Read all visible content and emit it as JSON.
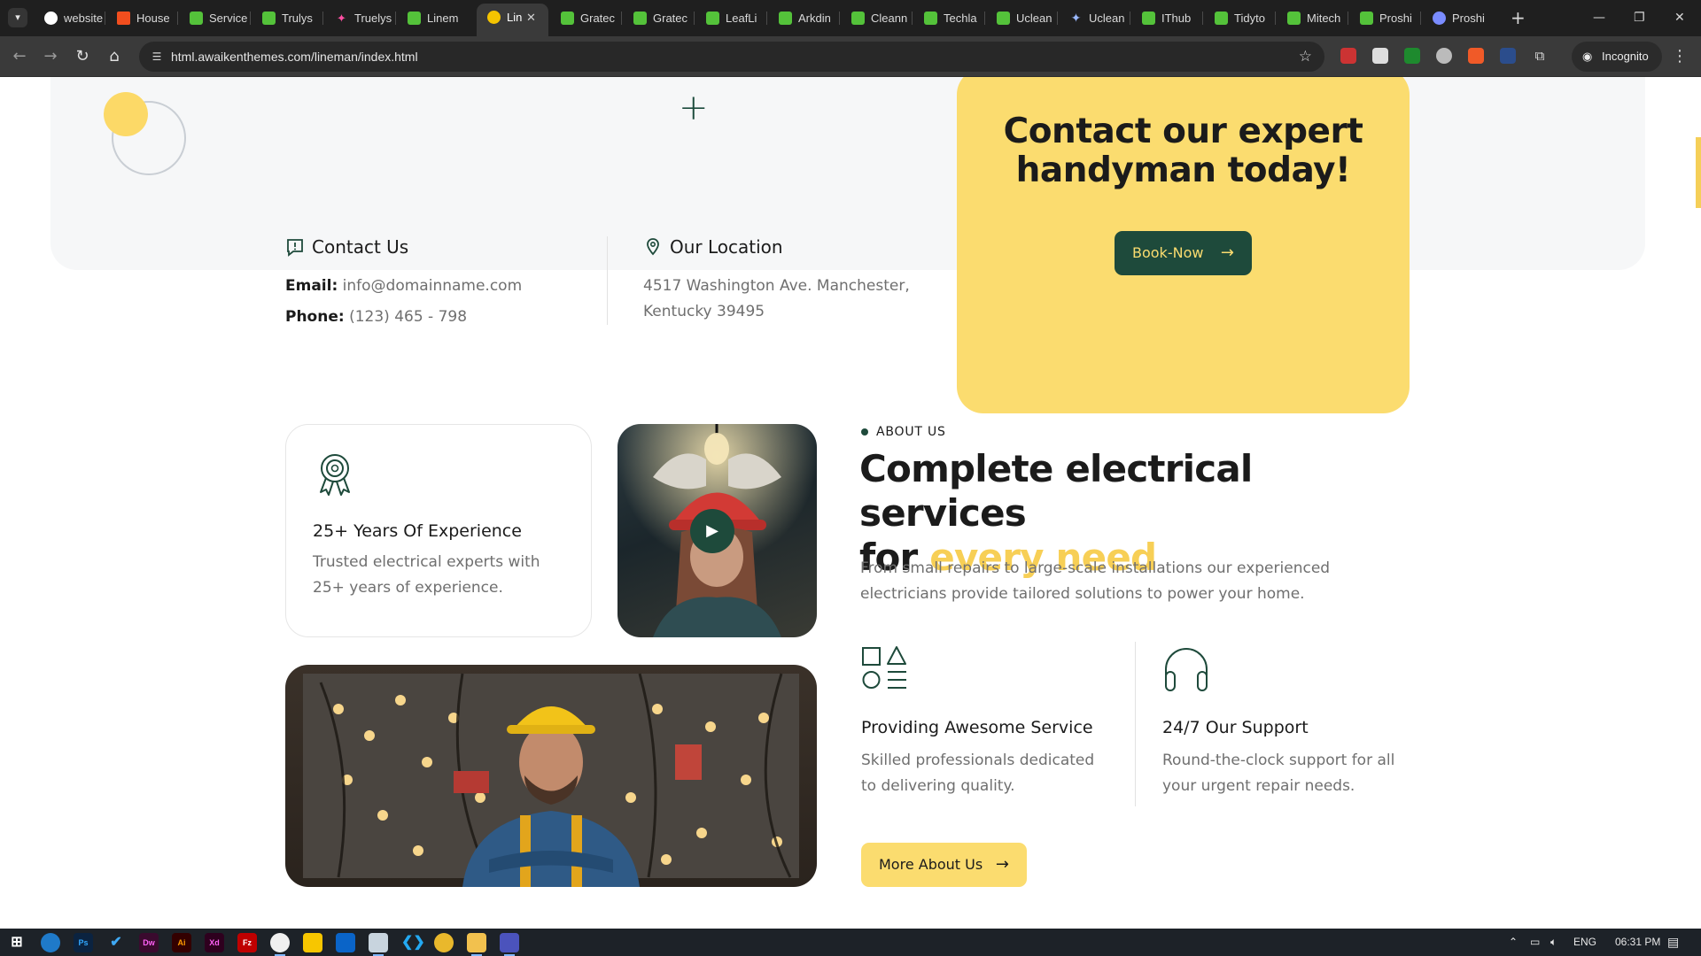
{
  "browser": {
    "tabs": [
      {
        "label": "website",
        "favicon": "google-icon"
      },
      {
        "label": "House",
        "favicon": "figma-icon"
      },
      {
        "label": "Service",
        "favicon": "leaf-icon"
      },
      {
        "label": "Trulys",
        "favicon": "leaf-icon"
      },
      {
        "label": "Truelys",
        "favicon": "sparkle-icon"
      },
      {
        "label": "Linem",
        "favicon": "leaf-icon"
      },
      {
        "label": "Lin",
        "favicon": "bulb-icon",
        "active": true
      },
      {
        "label": "Gratec",
        "favicon": "leaf-icon"
      },
      {
        "label": "Gratec",
        "favicon": "leaf-icon"
      },
      {
        "label": "LeafLi",
        "favicon": "leaf-icon"
      },
      {
        "label": "Arkdin",
        "favicon": "leaf-icon"
      },
      {
        "label": "Cleann",
        "favicon": "leaf-icon"
      },
      {
        "label": "Techla",
        "favicon": "leaf-icon"
      },
      {
        "label": "Uclean",
        "favicon": "leaf-icon"
      },
      {
        "label": "Uclean",
        "favicon": "gem-icon"
      },
      {
        "label": "IThub",
        "favicon": "leaf-icon"
      },
      {
        "label": "Tidyto",
        "favicon": "leaf-icon"
      },
      {
        "label": "Mitech",
        "favicon": "leaf-icon"
      },
      {
        "label": "Proshi",
        "favicon": "leaf-icon"
      },
      {
        "label": "Proshi",
        "favicon": "globe-icon"
      }
    ],
    "url": "html.awaikenthemes.com/lineman/index.html",
    "incognito_label": "Incognito"
  },
  "page": {
    "cta": {
      "title": "Contact our expert handyman today!",
      "button_label": "Book-Now"
    },
    "contact": {
      "title": "Contact Us",
      "email_label": "Email:",
      "email_value": "info@domainname.com",
      "phone_label": "Phone:",
      "phone_value": "(123) 465 - 798"
    },
    "location": {
      "title": "Our Location",
      "address_line1": "4517 Washington Ave. Manchester,",
      "address_line2": "Kentucky 39495"
    },
    "experience": {
      "title": "25+ Years Of Experience",
      "text": "Trusted electrical experts with 25+ years of experience."
    },
    "about": {
      "eyebrow": "ABOUT US",
      "heading_line1": "Complete electrical services",
      "heading_for": "for",
      "heading_highlight": "every need",
      "paragraph": "From small repairs to large-scale installations our experienced electricians provide tailored solutions to power your home.",
      "features": [
        {
          "title": "Providing Awesome Service",
          "text": "Skilled professionals dedicated to delivering quality."
        },
        {
          "title": "24/7 Our Support",
          "text": "Round-the-clock support for all your urgent repair needs."
        }
      ],
      "button_label": "More About Us"
    }
  },
  "taskbar": {
    "apps": [
      "Ps",
      "Dw",
      "Ai",
      "Xd",
      "Fz"
    ],
    "language": "ENG",
    "time": "06:31 PM"
  },
  "colors": {
    "accent_yellow": "#fbdc6f",
    "brand_green": "#1e4a3b",
    "highlight_yellow": "#f7cf56"
  }
}
